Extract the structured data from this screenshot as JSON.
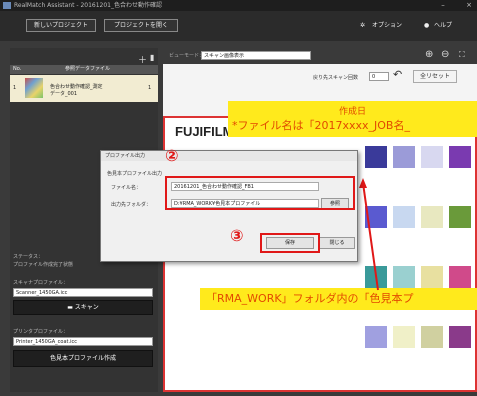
{
  "window": {
    "title": "RealMatch Assistant - 20161201_色合わせ動作確認",
    "minimize": "–",
    "close": "×"
  },
  "toolbar": {
    "new_project": "新しいプロジェクト",
    "open_project": "プロジェクトを開く",
    "options": "オプション",
    "help": "ヘルプ"
  },
  "list_header": {
    "no": "No.",
    "name": "参照データファイル"
  },
  "list_row": {
    "no": "1",
    "name_line1": "色合わせ動作確認_測定",
    "name_line2": "データ_001",
    "count": "1"
  },
  "left_panel": {
    "status_label": "ステータス：",
    "status_value": "プロファイル作成完了状態",
    "scanner_profile_label": "スキャナプロファイル：",
    "scanner_profile_value": "Scanner_1450GA.icc",
    "scan_button": "スキャン",
    "printer_profile_label": "プリンタプロファイル：",
    "printer_profile_value": "Printer_1450GA_coat.icc",
    "create_button": "色見本プロファイル作成"
  },
  "right_panel": {
    "view_mode_label": "ビューモード：",
    "view_mode_value": "スキャン画像表示",
    "recent_scan_label": "戻り先スキャン回数",
    "recent_scan_value": "0",
    "reset_button": "全リセット"
  },
  "document": {
    "brand": "FUJIFILM"
  },
  "callouts": {
    "top_line1": "作成日",
    "top_line2": "*ファイル名は「2017xxxx_JOB名_",
    "bottom": "「RMA_WORK」フォルダ内の「色見本プ"
  },
  "dialog": {
    "title": "プロファイル出力",
    "group_label": "色見本プロファイル出力",
    "filename_label": "ファイル名：",
    "filename_value": "20161201_色合わせ動作確認_FB1",
    "folder_label": "出力先フォルダ：",
    "folder_value": "D:¥RMA_WORK¥色見本プロファイル",
    "browse_button": "参照",
    "save_button": "保存",
    "close_button": "閉じる"
  },
  "markers": {
    "two": "②",
    "three": "③"
  },
  "swatch_colors": [
    "#3a3a9a",
    "#9b9bd8",
    "#d8d8f0",
    "#7a3ab0",
    "#5a5ad0",
    "#c8d8f0",
    "#e8e8c0",
    "#6a9a3a",
    "#3a9a9a",
    "#9ad0d0",
    "#e8e0a0",
    "#d04a8a",
    "#a0a0e0",
    "#f0f0c8",
    "#d0d0a0",
    "#8a3a8a"
  ]
}
